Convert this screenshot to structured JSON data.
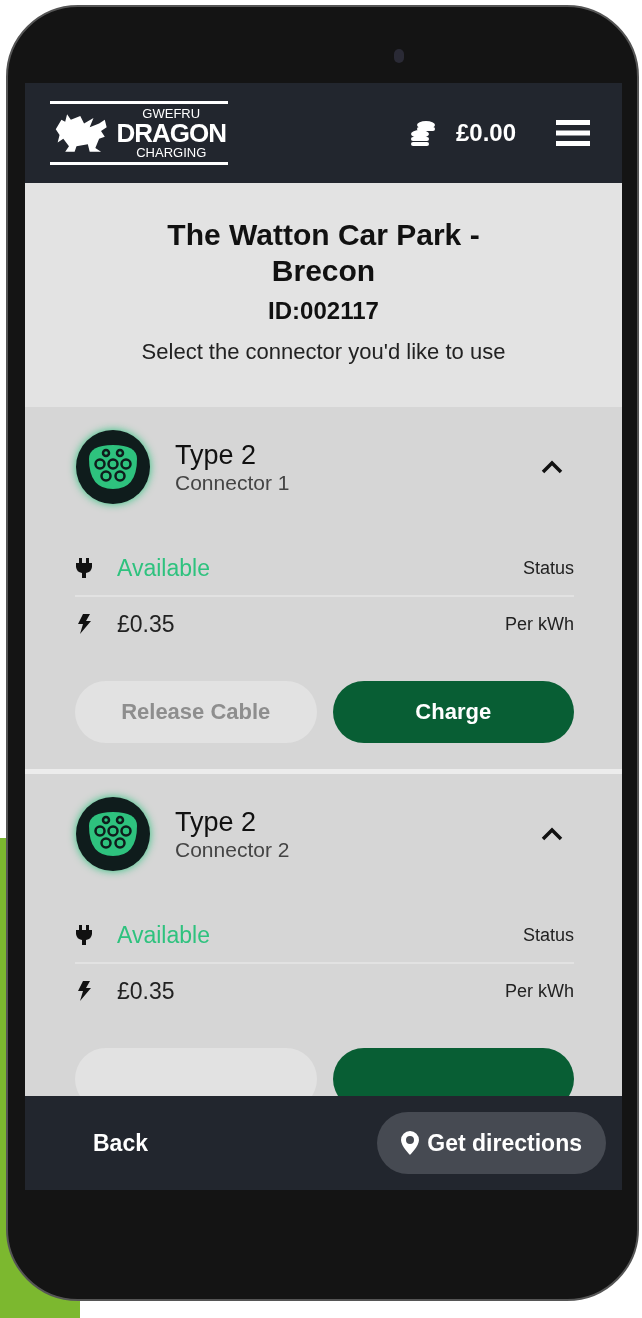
{
  "header": {
    "logo": {
      "top": "GWEFRU",
      "main": "DRAGON",
      "bottom": "CHARGING"
    },
    "balance": "£0.00"
  },
  "location": {
    "title": "The Watton Car Park - Brecon",
    "id": "ID:002117",
    "instruction": "Select the connector you'd like to use"
  },
  "connectors": [
    {
      "type": "Type 2",
      "name": "Connector 1",
      "expanded": true,
      "status": "Available",
      "status_label": "Status",
      "price": "£0.35",
      "price_label": "Per kWh",
      "buttons": [
        {
          "kind": "release",
          "label": "Release Cable",
          "disabled": true
        },
        {
          "kind": "charge",
          "label": "Charge",
          "disabled": false
        }
      ]
    },
    {
      "type": "Type 2",
      "name": "Connector 2",
      "expanded": true,
      "status": "Available",
      "status_label": "Status",
      "price": "£0.35",
      "price_label": "Per kWh",
      "buttons": [
        {
          "kind": "release",
          "disabled": true
        },
        {
          "kind": "charge",
          "disabled": false
        }
      ]
    }
  ],
  "footer": {
    "back": "Back",
    "directions": "Get directions"
  }
}
